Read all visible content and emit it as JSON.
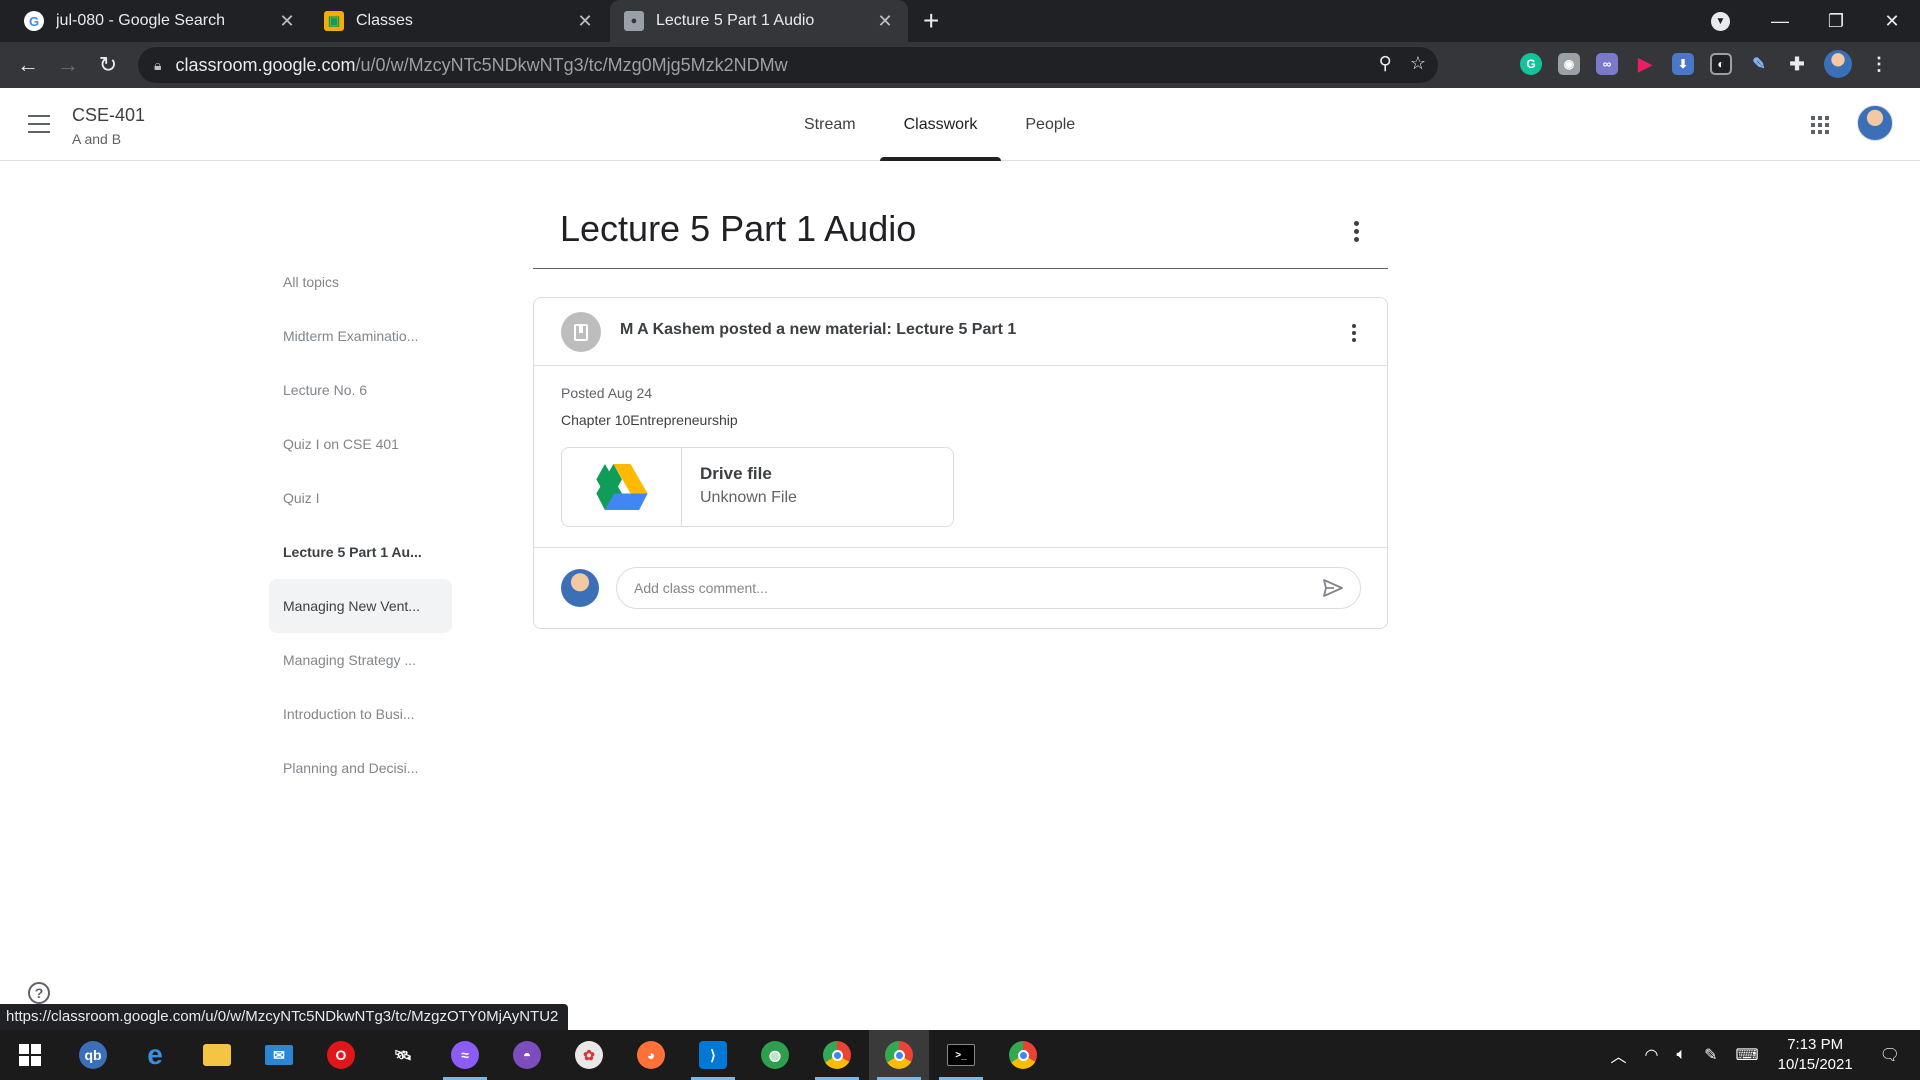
{
  "browser": {
    "tabs": [
      {
        "title": "jul-080 - Google Search",
        "favicon": "google-icon",
        "active": false
      },
      {
        "title": "Classes",
        "favicon": "classroom-icon",
        "active": false
      },
      {
        "title": "Lecture 5 Part 1 Audio",
        "favicon": "classroom-user-icon",
        "active": true
      }
    ],
    "url_host": "classroom.google.com",
    "url_path": "/u/0/w/MzcyNTc5NDkwNTg3/tc/Mzg0Mjg5Mzk2NDMw"
  },
  "classroom": {
    "course_title": "CSE-401",
    "course_section": "A and B",
    "nav_tabs": [
      "Stream",
      "Classwork",
      "People"
    ],
    "active_tab": "Classwork"
  },
  "sidebar": {
    "topics": [
      {
        "label": "All topics",
        "state": "normal"
      },
      {
        "label": "Midterm Examinatio...",
        "state": "normal"
      },
      {
        "label": "Lecture No. 6",
        "state": "normal"
      },
      {
        "label": "Quiz I on CSE 401",
        "state": "normal"
      },
      {
        "label": "Quiz I",
        "state": "normal"
      },
      {
        "label": "Lecture 5 Part 1 Au...",
        "state": "bold"
      },
      {
        "label": "Managing New Vent...",
        "state": "selected"
      },
      {
        "label": "Managing Strategy ...",
        "state": "normal"
      },
      {
        "label": "Introduction to Busi...",
        "state": "normal"
      },
      {
        "label": "Planning and Decisi...",
        "state": "normal"
      }
    ]
  },
  "topic": {
    "title": "Lecture 5 Part 1 Audio"
  },
  "material": {
    "headline": "M A Kashem posted a new material: Lecture 5 Part 1",
    "posted": "Posted Aug 24",
    "description": "Chapter 10Entrepreneurship",
    "attachment_name": "Drive file",
    "attachment_type": "Unknown File",
    "comment_placeholder": "Add class comment..."
  },
  "status_bar_url": "https://classroom.google.com/u/0/w/MzcyNTc5NDkwNTg3/tc/MzgzOTY0MjAyNTU2",
  "taskbar": {
    "time": "7:13 PM",
    "date": "10/15/2021"
  },
  "colors": {
    "chrome_dark": "#202124",
    "chrome_toolbar": "#35363a",
    "selected_topic_bg": "#f1f3f4",
    "active_tab_underline": "#202124"
  }
}
